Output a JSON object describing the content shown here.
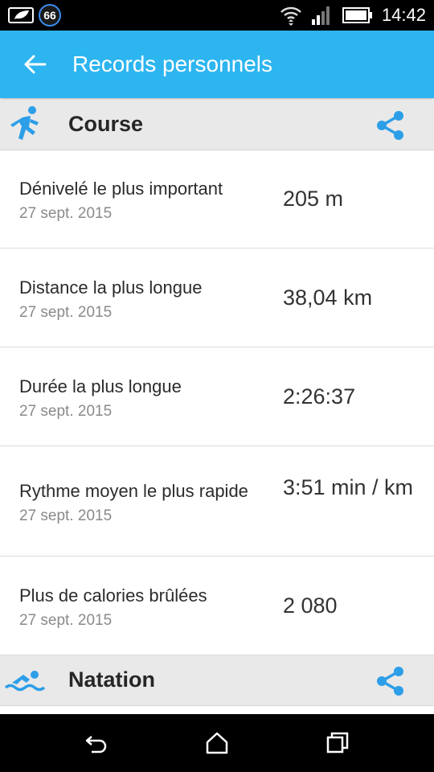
{
  "status_bar": {
    "notification_count": "66",
    "time": "14:42"
  },
  "app_bar": {
    "title": "Records personnels"
  },
  "sections": [
    {
      "title": "Course",
      "icon": "running-icon",
      "records": [
        {
          "label": "Dénivelé le plus important",
          "date": "27 sept. 2015",
          "value": "205 m"
        },
        {
          "label": "Distance la plus longue",
          "date": "27 sept. 2015",
          "value": "38,04 km"
        },
        {
          "label": "Durée la plus longue",
          "date": "27 sept. 2015",
          "value": "2:26:37"
        },
        {
          "label": "Rythme moyen le plus rapide",
          "date": "27 sept. 2015",
          "value": "3:51 min / km"
        },
        {
          "label": "Plus de calories brûlées",
          "date": "27 sept. 2015",
          "value": "2 080"
        }
      ]
    },
    {
      "title": "Natation",
      "icon": "swimming-icon",
      "records": []
    }
  ],
  "colors": {
    "accent": "#2db5f0",
    "share_icon": "#2d9ee8",
    "section_bg": "#e9e9e9"
  }
}
